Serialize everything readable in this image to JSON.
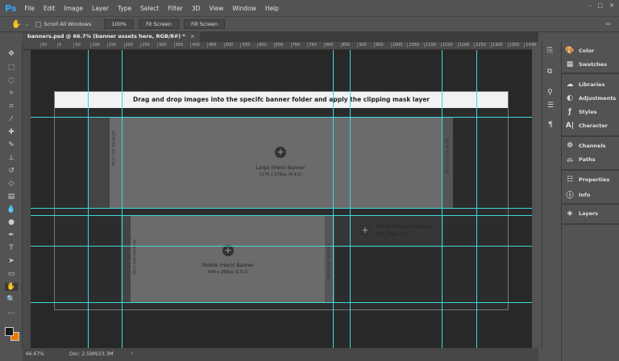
{
  "app": {
    "logo": "Ps",
    "menu": [
      "File",
      "Edit",
      "Image",
      "Layer",
      "Type",
      "Select",
      "Filter",
      "3D",
      "View",
      "Window",
      "Help"
    ]
  },
  "options": {
    "scroll_all_windows": "Scroll All Windows",
    "zoom_100": "100%",
    "fit_screen": "Fit Screen",
    "fill_screen": "Fill Screen"
  },
  "document": {
    "tab_title": "banners.psd @ 66.7% (banner assets here, RGB/8#) *",
    "close": "×"
  },
  "ruler_ticks": [
    "50",
    "0",
    "50",
    "100",
    "150",
    "200",
    "250",
    "300",
    "350",
    "400",
    "450",
    "500",
    "550",
    "600",
    "650",
    "700",
    "750",
    "800",
    "850",
    "900",
    "950",
    "1000",
    "1050",
    "1100",
    "1150",
    "1200",
    "1250",
    "1300",
    "1350",
    "1400"
  ],
  "canvas": {
    "instruction": "Drag and drop images into the specifc banner folder and apply the clipping mask layer",
    "safe_zone": "ARTWORK SAFE ZONE",
    "banners": [
      {
        "title": "Large (Hero) Banner",
        "size": "1170 x 276px (4.3:1)"
      },
      {
        "title": "Mobile (Hero) Banner",
        "size": "640 x 260px (2.5:1)"
      },
      {
        "title": "Small (Feature) Banner",
        "size": "276 x 92px (3:1)"
      }
    ]
  },
  "status": {
    "zoom": "66.67%",
    "doc": "Doc: 2.59M/23.3M"
  },
  "panels": [
    {
      "label": "Color",
      "icon": "palette"
    },
    {
      "label": "Swatches",
      "icon": "grid"
    },
    {
      "label": "Libraries",
      "icon": "cc-libraries"
    },
    {
      "label": "Adjustments",
      "icon": "half-circle"
    },
    {
      "label": "Styles",
      "icon": "fx"
    },
    {
      "label": "Character",
      "icon": "type-A"
    },
    {
      "label": "Channels",
      "icon": "channels"
    },
    {
      "label": "Paths",
      "icon": "pen-path"
    },
    {
      "label": "Properties",
      "icon": "sliders"
    },
    {
      "label": "Info",
      "icon": "info"
    },
    {
      "label": "Layers",
      "icon": "layers"
    }
  ],
  "colors": {
    "guide": "#3fd8dc",
    "foreground": "#1a1a1a",
    "background": "#f07800"
  }
}
